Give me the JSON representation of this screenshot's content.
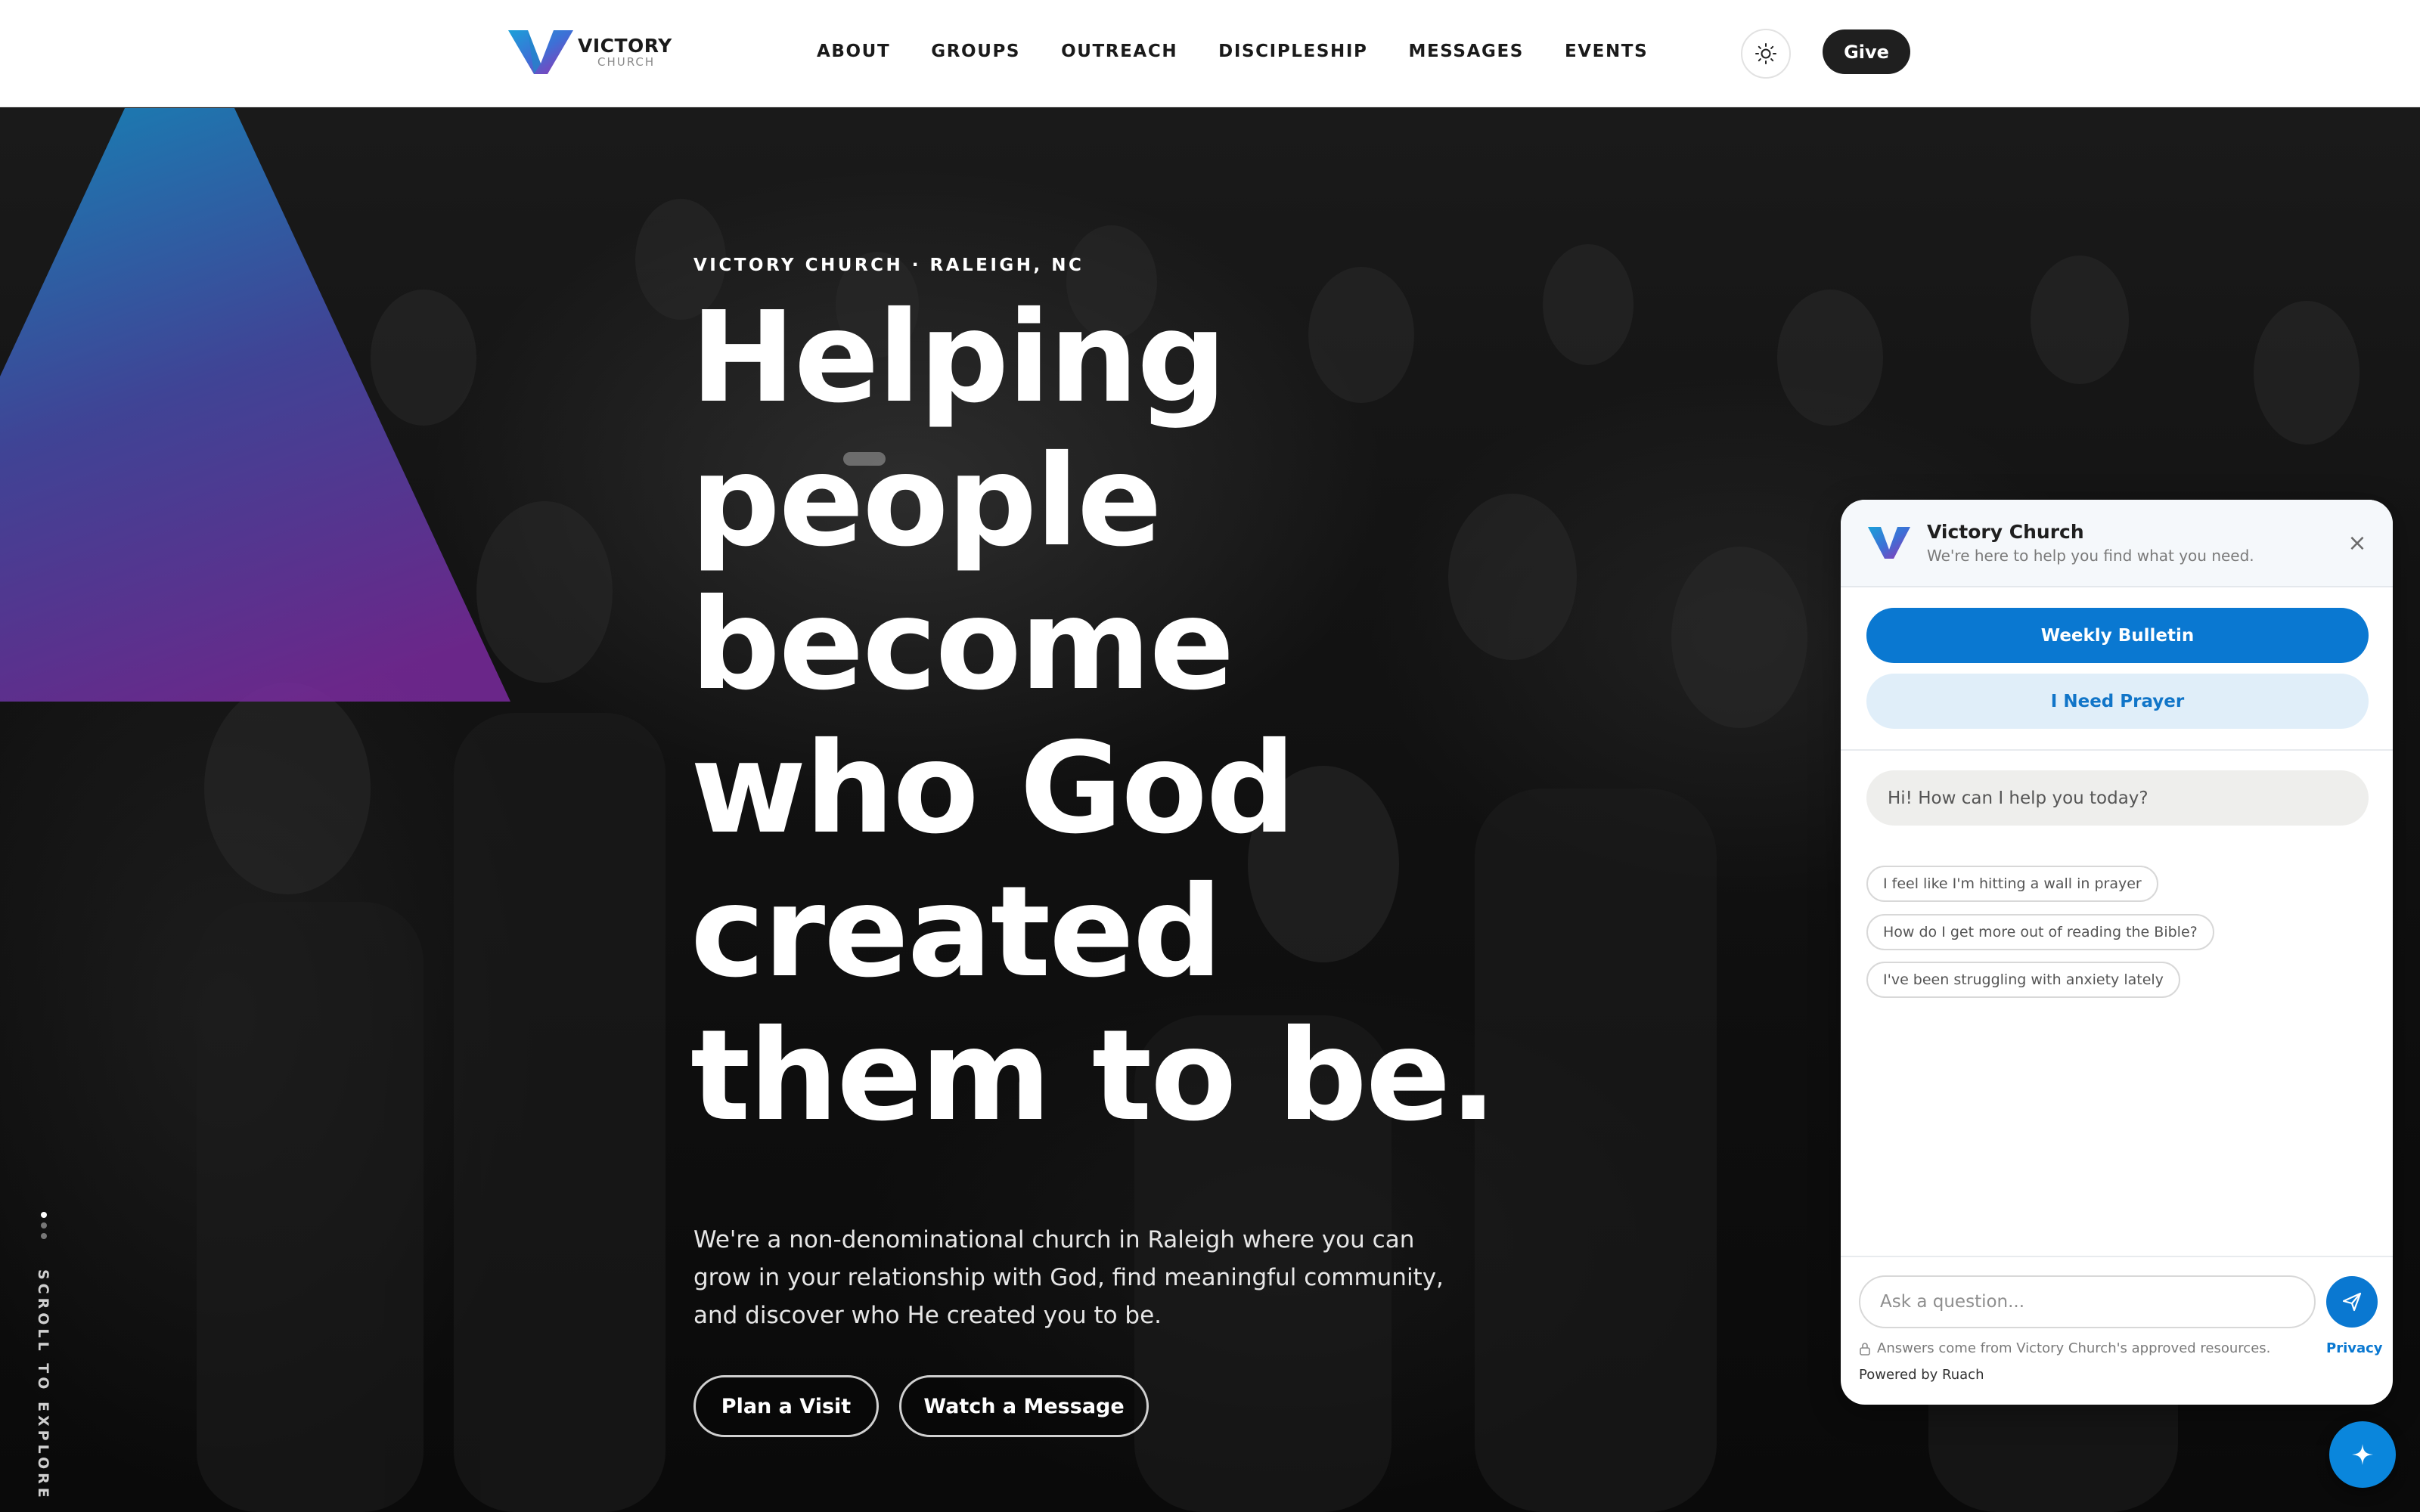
{
  "brand": {
    "name": "VICTORY",
    "sub": "CHURCH"
  },
  "nav": {
    "items": [
      "ABOUT",
      "GROUPS",
      "OUTREACH",
      "DISCIPLESHIP",
      "MESSAGES",
      "EVENTS"
    ]
  },
  "header": {
    "theme_toggle_icon": "sun-icon",
    "give_label": "Give"
  },
  "hero": {
    "eyebrow": "VICTORY CHURCH · RALEIGH, NC",
    "headline_lines": [
      "Helping",
      "people",
      "become",
      "who God",
      "created",
      "them to be."
    ],
    "intro_lines": [
      "We're a non-denominational church in Raleigh where you can",
      "grow in your relationship with God, find meaningful community,",
      "and discover who He created you to be."
    ],
    "cta_visit": "Plan a Visit",
    "cta_watch": "Watch a Message",
    "scroll_label": "SCROLL TO EXPLORE"
  },
  "chat": {
    "title": "Victory Church",
    "subtitle": "We're here to help you find what you need.",
    "close_icon": "close-icon",
    "quick_actions": [
      "Weekly Bulletin",
      "I Need Prayer"
    ],
    "greeting": "Hi! How can I help you today?",
    "suggestions": [
      "I feel like I'm hitting a wall in prayer",
      "How do I get more out of reading the Bible?",
      "I've been struggling with anxiety lately"
    ],
    "input_placeholder": "Ask a question...",
    "disclaimer": "Answers come from Victory Church's approved resources.",
    "privacy_label": "Privacy",
    "powered_by": "Powered by Ruach"
  },
  "colors": {
    "accent_blue": "#0a78d1",
    "dark_button": "#1f1f1f",
    "triangle_top": "#1f7fc2",
    "triangle_bottom": "#7a2a9e"
  }
}
